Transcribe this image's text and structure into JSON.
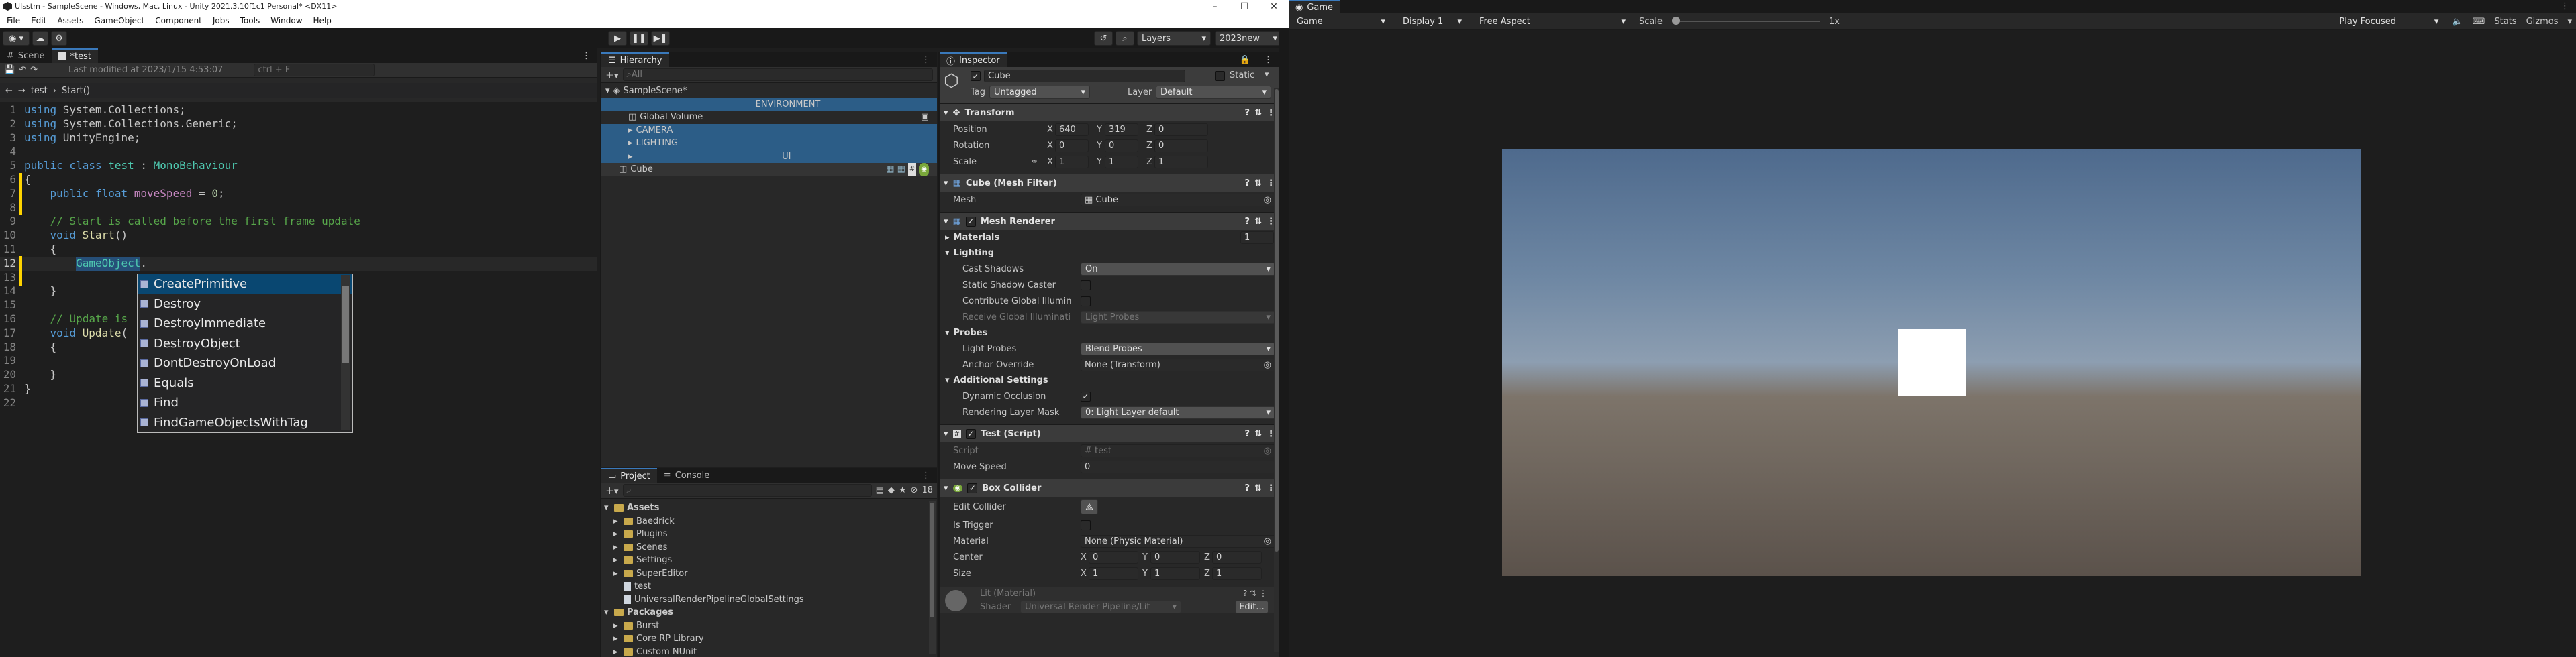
{
  "os": {
    "title": "UIsstm - SampleScene - Windows, Mac, Linux - Unity 2021.3.10f1c1 Personal* <DX11>",
    "menu": [
      "File",
      "Edit",
      "Assets",
      "GameObject",
      "Component",
      "Jobs",
      "Tools",
      "Window",
      "Help"
    ]
  },
  "toolbar": {
    "layers_label": "Layers",
    "layout_label": "2023new"
  },
  "editor": {
    "tabs": {
      "scene": "Scene",
      "test": "*test"
    },
    "last_modified": "Last modified at 2023/1/15 4:53:07",
    "search_hint": "ctrl + F",
    "breadcrumb": {
      "file": "test",
      "method": "Start()"
    },
    "lines": [
      {
        "n": "1",
        "t": [
          [
            "kw",
            "using"
          ],
          [
            "",
            "System.Collections;"
          ]
        ]
      },
      {
        "n": "2",
        "t": [
          [
            "kw",
            "using"
          ],
          [
            "",
            "System.Collections.Generic;"
          ]
        ]
      },
      {
        "n": "3",
        "t": [
          [
            "kw",
            "using"
          ],
          [
            "",
            "UnityEngine;"
          ]
        ]
      },
      {
        "n": "4",
        "t": []
      },
      {
        "n": "5",
        "t": [
          [
            "kw",
            "public class"
          ],
          [
            "ty",
            "test"
          ],
          [
            "",
            " : "
          ],
          [
            "ty",
            "MonoBehaviour"
          ]
        ]
      },
      {
        "n": "6",
        "t": [
          [
            "",
            "{"
          ]
        ]
      },
      {
        "n": "7",
        "t": [
          [
            "",
            "    "
          ],
          [
            "kw",
            "public float"
          ],
          [
            "fld",
            "moveSpeed"
          ],
          [
            "",
            " = "
          ],
          [
            "nm",
            "0"
          ],
          [
            "",
            ";"
          ]
        ]
      },
      {
        "n": "8",
        "t": []
      },
      {
        "n": "9",
        "t": [
          [
            "",
            "    "
          ],
          [
            "cm",
            "// Start is called before the first frame update"
          ]
        ]
      },
      {
        "n": "10",
        "t": [
          [
            "",
            "    "
          ],
          [
            "kw",
            "void"
          ],
          [
            "fn",
            "Start"
          ],
          [
            "",
            "()"
          ]
        ]
      },
      {
        "n": "11",
        "t": [
          [
            "",
            "    {"
          ]
        ]
      },
      {
        "n": "12",
        "t": [
          [
            "",
            "        "
          ],
          [
            "ty",
            "GameObject"
          ],
          [
            "",
            "."
          ]
        ]
      },
      {
        "n": "13",
        "t": []
      },
      {
        "n": "14",
        "t": [
          [
            "",
            "    }"
          ]
        ]
      },
      {
        "n": "15",
        "t": []
      },
      {
        "n": "16",
        "t": [
          [
            "",
            "    "
          ],
          [
            "cm",
            "// Update is"
          ]
        ]
      },
      {
        "n": "17",
        "t": [
          [
            "",
            "    "
          ],
          [
            "kw",
            "void"
          ],
          [
            "fn",
            "Update"
          ],
          [
            "",
            "("
          ]
        ]
      },
      {
        "n": "18",
        "t": [
          [
            "",
            "    {"
          ]
        ]
      },
      {
        "n": "19",
        "t": []
      },
      {
        "n": "20",
        "t": [
          [
            "",
            "    }"
          ]
        ]
      },
      {
        "n": "21",
        "t": [
          [
            "",
            "}"
          ]
        ]
      },
      {
        "n": "22",
        "t": []
      }
    ],
    "autocomplete": [
      "CreatePrimitive",
      "Destroy",
      "DestroyImmediate",
      "DestroyObject",
      "DontDestroyOnLoad",
      "Equals",
      "Find",
      "FindGameObjectsWithTag"
    ]
  },
  "hierarchy": {
    "tab": "Hierarchy",
    "search_placeholder": "All",
    "scene": "SampleScene*",
    "items": [
      "ENVIRONMENT",
      "Global Volume",
      "CAMERA",
      "LIGHTING",
      "UI",
      "Cube"
    ]
  },
  "project": {
    "tabs": {
      "project": "Project",
      "console": "Console"
    },
    "count": "18",
    "assets_label": "Assets",
    "assets": [
      "Baedrick",
      "Plugins",
      "Scenes",
      "Settings",
      "SuperEditor",
      "test",
      "UniversalRenderPipelineGlobalSettings"
    ],
    "packages_label": "Packages",
    "packages": [
      "Burst",
      "Core RP Library",
      "Custom NUnit"
    ]
  },
  "inspector": {
    "tab": "Inspector",
    "name": "Cube",
    "static_label": "Static",
    "tag_label": "Tag",
    "tag": "Untagged",
    "layer_label": "Layer",
    "layer": "Default",
    "transform": {
      "title": "Transform",
      "position_label": "Position",
      "position": [
        "640",
        "319",
        "0"
      ],
      "rotation_label": "Rotation",
      "rotation": [
        "0",
        "0",
        "0"
      ],
      "scale_label": "Scale",
      "scale": [
        "1",
        "1",
        "1"
      ]
    },
    "mesh_filter": {
      "title": "Cube (Mesh Filter)",
      "mesh_label": "Mesh",
      "mesh": "Cube"
    },
    "mesh_renderer": {
      "title": "Mesh Renderer",
      "materials_label": "Materials",
      "materials_count": "1",
      "lighting_label": "Lighting",
      "cast_shadows_label": "Cast Shadows",
      "cast_shadows": "On",
      "static_shadow_label": "Static Shadow Caster",
      "contribute_gi_label": "Contribute Global Illumin",
      "receive_gi_label": "Receive Global Illuminati",
      "receive_gi": "Light Probes",
      "probes_label": "Probes",
      "light_probes_label": "Light Probes",
      "light_probes": "Blend Probes",
      "anchor_label": "Anchor Override",
      "anchor": "None (Transform)",
      "additional_label": "Additional Settings",
      "occlusion_label": "Dynamic Occlusion",
      "layer_mask_label": "Rendering Layer Mask",
      "layer_mask": "0: Light Layer default"
    },
    "script_comp": {
      "title": "Test (Script)",
      "script_label": "Script",
      "script": "test",
      "move_label": "Move Speed",
      "move_value": "0"
    },
    "box_collider": {
      "title": "Box Collider",
      "edit_label": "Edit Collider",
      "trigger_label": "Is Trigger",
      "material_label": "Material",
      "material": "None (Physic Material)",
      "center_label": "Center",
      "center": [
        "0",
        "0",
        "0"
      ],
      "size_label": "Size",
      "size": [
        "1",
        "1",
        "1"
      ]
    },
    "material": {
      "title": "Lit (Material)",
      "shader_label": "Shader",
      "shader": "Universal Render Pipeline/Lit",
      "edit_label": "Edit..."
    }
  },
  "game": {
    "tab": "Game",
    "mode": "Game",
    "display": "Display 1",
    "aspect": "Free Aspect",
    "scale_label": "Scale",
    "scale_value": "1x",
    "play_focused": "Play Focused",
    "stats": "Stats",
    "gizmos": "Gizmos"
  },
  "colors": {
    "accent": "#3a79bb",
    "selection": "#2c5d87",
    "cube": "#ffffff"
  }
}
